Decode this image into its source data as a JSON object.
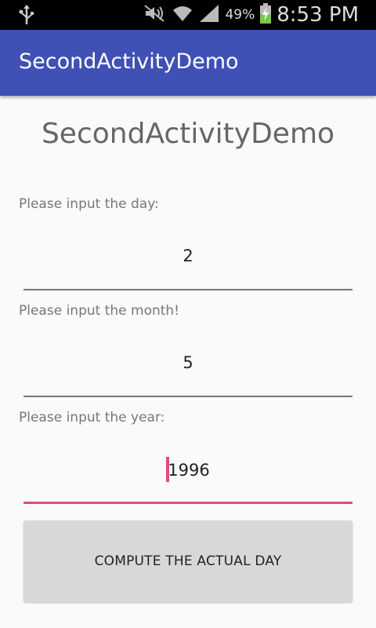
{
  "status_bar": {
    "usb_icon": "usb-icon",
    "battery_percent": "49%",
    "time": "8:53 PM"
  },
  "app_bar": {
    "title": "SecondActivityDemo"
  },
  "main": {
    "title": "SecondActivityDemo",
    "day": {
      "label": "Please input the day:",
      "value": "2"
    },
    "month": {
      "label": "Please input the month!",
      "value": "5"
    },
    "year": {
      "label": "Please input the year:",
      "value": "1996"
    },
    "compute_button": "COMPUTE THE ACTUAL DAY"
  },
  "colors": {
    "primary": "#3f51b5",
    "accent": "#e04a82"
  }
}
